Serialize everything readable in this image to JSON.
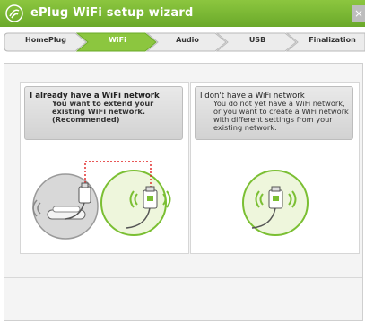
{
  "window": {
    "title": "ePlug WiFi setup wizard",
    "close_label": "×"
  },
  "steps": [
    {
      "label": "HomePlug",
      "active": false
    },
    {
      "label": "WiFi",
      "active": true
    },
    {
      "label": "Audio",
      "active": false
    },
    {
      "label": "USB",
      "active": false
    },
    {
      "label": "Finalization",
      "active": false
    }
  ],
  "options": {
    "existing": {
      "title": "I already have a WiFi network",
      "description": "You want to extend your existing WiFi network. (Recommended)"
    },
    "new": {
      "title": "I don't have a WiFi network",
      "description": "You do not yet have a WiFi network, or you want to create a WiFi network with different settings from your existing network."
    }
  },
  "colors": {
    "brand_green": "#7bbf33",
    "step_active": "#8cc63f",
    "panel_bg": "#f4f4f4"
  }
}
